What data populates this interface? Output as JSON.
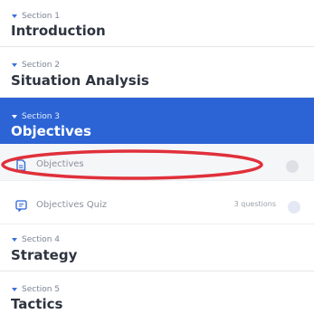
{
  "sections": [
    {
      "label": "Section 1",
      "title": "Introduction"
    },
    {
      "label": "Section 2",
      "title": "Situation Analysis"
    },
    {
      "label": "Section 3",
      "title": "Objectives"
    },
    {
      "label": "Section 4",
      "title": "Strategy"
    },
    {
      "label": "Section 5",
      "title": "Tactics"
    }
  ],
  "lessons": [
    {
      "label": "Objectives",
      "icon": "document-icon"
    },
    {
      "label": "Objectives Quiz",
      "meta": "3 questions",
      "icon": "quiz-icon"
    }
  ],
  "colors": {
    "accent": "#2c64d6",
    "highlight_annotation": "#e0303a",
    "muted_text": "#8a909a"
  }
}
